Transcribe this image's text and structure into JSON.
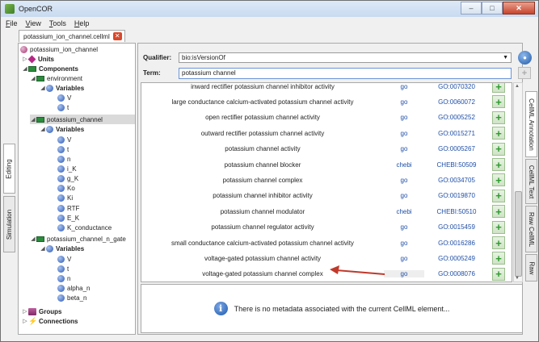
{
  "window": {
    "title": "OpenCOR",
    "buttons": {
      "minimize": "–",
      "maximize": "□",
      "close": "✕"
    }
  },
  "menu": [
    "File",
    "View",
    "Tools",
    "Help"
  ],
  "file_tab": {
    "label": "potassium_ion_channel.cellml",
    "close": "✕"
  },
  "left_tabs": [
    "Editing",
    "Simulation"
  ],
  "tree": {
    "model": "potassium_ion_channel",
    "units": "Units",
    "components": "Components",
    "environment": "environment",
    "variables": "Variables",
    "env_vars": [
      "V",
      "t"
    ],
    "potassium_channel": "potassium_channel",
    "pc_vars": [
      "V",
      "t",
      "n",
      "i_K",
      "g_K",
      "Ko",
      "Ki",
      "RTF",
      "E_K",
      "K_conductance"
    ],
    "gate": "potassium_channel_n_gate",
    "gate_vars": [
      "V",
      "t",
      "n",
      "alpha_n",
      "beta_n"
    ],
    "groups": "Groups",
    "connections": "Connections"
  },
  "qualifier": {
    "label": "Qualifier:",
    "value": "bio:isVersionOf"
  },
  "term": {
    "label": "Term:",
    "value": "potassium channel"
  },
  "results": [
    {
      "name": "inward rectifier potassium channel inhibitor activity",
      "resource": "go",
      "id": "GO:0070320"
    },
    {
      "name": "large conductance calcium-activated potassium channel activity",
      "resource": "go",
      "id": "GO:0060072"
    },
    {
      "name": "open rectifier potassium channel activity",
      "resource": "go",
      "id": "GO:0005252"
    },
    {
      "name": "outward rectifier potassium channel activity",
      "resource": "go",
      "id": "GO:0015271"
    },
    {
      "name": "potassium channel activity",
      "resource": "go",
      "id": "GO:0005267"
    },
    {
      "name": "potassium channel blocker",
      "resource": "chebi",
      "id": "CHEBI:50509"
    },
    {
      "name": "potassium channel complex",
      "resource": "go",
      "id": "GO:0034705"
    },
    {
      "name": "potassium channel inhibitor activity",
      "resource": "go",
      "id": "GO:0019870"
    },
    {
      "name": "potassium channel modulator",
      "resource": "chebi",
      "id": "CHEBI:50510"
    },
    {
      "name": "potassium channel regulator activity",
      "resource": "go",
      "id": "GO:0015459"
    },
    {
      "name": "small conductance calcium-activated potassium channel activity",
      "resource": "go",
      "id": "GO:0016286"
    },
    {
      "name": "voltage-gated potassium channel activity",
      "resource": "go",
      "id": "GO:0005249"
    },
    {
      "name": "voltage-gated potassium channel complex",
      "resource": "go",
      "id": "GO:0008076"
    }
  ],
  "info_message": "There is no metadata associated with the current CellML element...",
  "right_tabs": [
    "CellML Annotation",
    "CellML Text",
    "Raw CellML",
    "Raw"
  ],
  "colors": {
    "link": "#1f4fa8",
    "add": "#2f9a2f",
    "annotation_arrow": "#c0392b"
  },
  "icons": [
    "globe-icon",
    "info-icon",
    "add-icon",
    "arrow-annotation-icon"
  ]
}
